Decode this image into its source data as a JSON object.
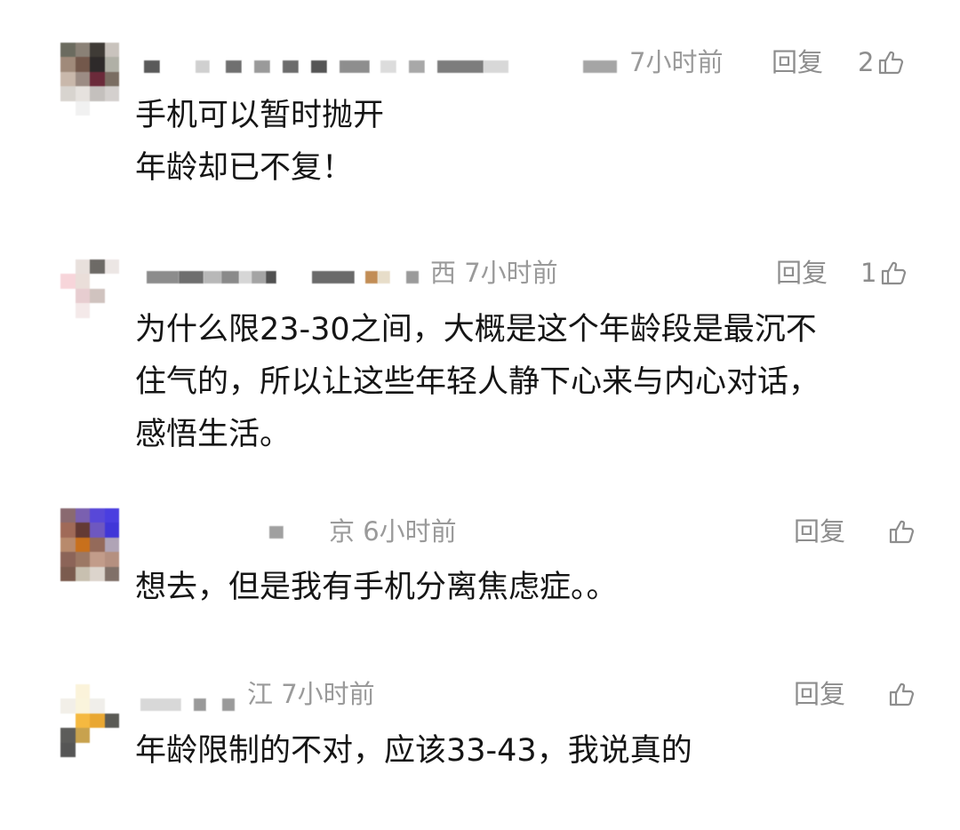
{
  "comments": [
    {
      "location_time": "7小时前",
      "reply_label": "回复",
      "like_count": "2",
      "text": "手机可以暂时抛开\n年龄却已不复！"
    },
    {
      "location_time": "西 7小时前",
      "reply_label": "回复",
      "like_count": "1",
      "text": "为什么限23-30之间，大概是这个年龄段是最沉不\n住气的，所以让这些年轻人静下心来与内心对话，\n感悟生活。"
    },
    {
      "location_time": "京 6小时前",
      "reply_label": "回复",
      "like_count": "",
      "text": "想去，但是我有手机分离焦虑症。。"
    },
    {
      "location_time": "江 7小时前",
      "reply_label": "回复",
      "like_count": "",
      "text": "年龄限制的不对，应该33-43，我说真的"
    }
  ],
  "icons": {
    "like": "thumbs-up-icon"
  },
  "colors": {
    "text": "#151515",
    "meta": "#9a9a9a",
    "icon": "#8d8d8d"
  }
}
